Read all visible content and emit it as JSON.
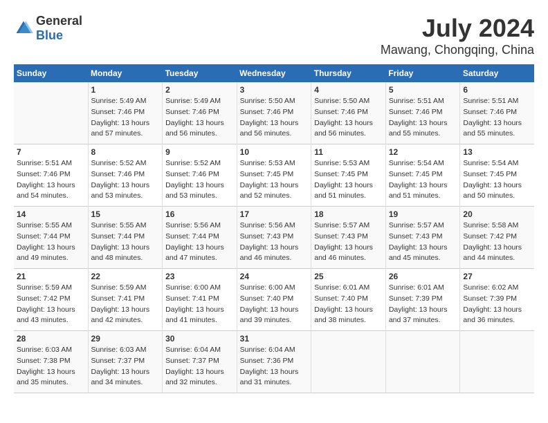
{
  "logo": {
    "text_general": "General",
    "text_blue": "Blue"
  },
  "title": "July 2024",
  "subtitle": "Mawang, Chongqing, China",
  "days_of_week": [
    "Sunday",
    "Monday",
    "Tuesday",
    "Wednesday",
    "Thursday",
    "Friday",
    "Saturday"
  ],
  "weeks": [
    [
      {
        "day": "",
        "sunrise": "",
        "sunset": "",
        "daylight": ""
      },
      {
        "day": "1",
        "sunrise": "Sunrise: 5:49 AM",
        "sunset": "Sunset: 7:46 PM",
        "daylight": "Daylight: 13 hours and 57 minutes."
      },
      {
        "day": "2",
        "sunrise": "Sunrise: 5:49 AM",
        "sunset": "Sunset: 7:46 PM",
        "daylight": "Daylight: 13 hours and 56 minutes."
      },
      {
        "day": "3",
        "sunrise": "Sunrise: 5:50 AM",
        "sunset": "Sunset: 7:46 PM",
        "daylight": "Daylight: 13 hours and 56 minutes."
      },
      {
        "day": "4",
        "sunrise": "Sunrise: 5:50 AM",
        "sunset": "Sunset: 7:46 PM",
        "daylight": "Daylight: 13 hours and 56 minutes."
      },
      {
        "day": "5",
        "sunrise": "Sunrise: 5:51 AM",
        "sunset": "Sunset: 7:46 PM",
        "daylight": "Daylight: 13 hours and 55 minutes."
      },
      {
        "day": "6",
        "sunrise": "Sunrise: 5:51 AM",
        "sunset": "Sunset: 7:46 PM",
        "daylight": "Daylight: 13 hours and 55 minutes."
      }
    ],
    [
      {
        "day": "7",
        "sunrise": "Sunrise: 5:51 AM",
        "sunset": "Sunset: 7:46 PM",
        "daylight": "Daylight: 13 hours and 54 minutes."
      },
      {
        "day": "8",
        "sunrise": "Sunrise: 5:52 AM",
        "sunset": "Sunset: 7:46 PM",
        "daylight": "Daylight: 13 hours and 53 minutes."
      },
      {
        "day": "9",
        "sunrise": "Sunrise: 5:52 AM",
        "sunset": "Sunset: 7:46 PM",
        "daylight": "Daylight: 13 hours and 53 minutes."
      },
      {
        "day": "10",
        "sunrise": "Sunrise: 5:53 AM",
        "sunset": "Sunset: 7:45 PM",
        "daylight": "Daylight: 13 hours and 52 minutes."
      },
      {
        "day": "11",
        "sunrise": "Sunrise: 5:53 AM",
        "sunset": "Sunset: 7:45 PM",
        "daylight": "Daylight: 13 hours and 51 minutes."
      },
      {
        "day": "12",
        "sunrise": "Sunrise: 5:54 AM",
        "sunset": "Sunset: 7:45 PM",
        "daylight": "Daylight: 13 hours and 51 minutes."
      },
      {
        "day": "13",
        "sunrise": "Sunrise: 5:54 AM",
        "sunset": "Sunset: 7:45 PM",
        "daylight": "Daylight: 13 hours and 50 minutes."
      }
    ],
    [
      {
        "day": "14",
        "sunrise": "Sunrise: 5:55 AM",
        "sunset": "Sunset: 7:44 PM",
        "daylight": "Daylight: 13 hours and 49 minutes."
      },
      {
        "day": "15",
        "sunrise": "Sunrise: 5:55 AM",
        "sunset": "Sunset: 7:44 PM",
        "daylight": "Daylight: 13 hours and 48 minutes."
      },
      {
        "day": "16",
        "sunrise": "Sunrise: 5:56 AM",
        "sunset": "Sunset: 7:44 PM",
        "daylight": "Daylight: 13 hours and 47 minutes."
      },
      {
        "day": "17",
        "sunrise": "Sunrise: 5:56 AM",
        "sunset": "Sunset: 7:43 PM",
        "daylight": "Daylight: 13 hours and 46 minutes."
      },
      {
        "day": "18",
        "sunrise": "Sunrise: 5:57 AM",
        "sunset": "Sunset: 7:43 PM",
        "daylight": "Daylight: 13 hours and 46 minutes."
      },
      {
        "day": "19",
        "sunrise": "Sunrise: 5:57 AM",
        "sunset": "Sunset: 7:43 PM",
        "daylight": "Daylight: 13 hours and 45 minutes."
      },
      {
        "day": "20",
        "sunrise": "Sunrise: 5:58 AM",
        "sunset": "Sunset: 7:42 PM",
        "daylight": "Daylight: 13 hours and 44 minutes."
      }
    ],
    [
      {
        "day": "21",
        "sunrise": "Sunrise: 5:59 AM",
        "sunset": "Sunset: 7:42 PM",
        "daylight": "Daylight: 13 hours and 43 minutes."
      },
      {
        "day": "22",
        "sunrise": "Sunrise: 5:59 AM",
        "sunset": "Sunset: 7:41 PM",
        "daylight": "Daylight: 13 hours and 42 minutes."
      },
      {
        "day": "23",
        "sunrise": "Sunrise: 6:00 AM",
        "sunset": "Sunset: 7:41 PM",
        "daylight": "Daylight: 13 hours and 41 minutes."
      },
      {
        "day": "24",
        "sunrise": "Sunrise: 6:00 AM",
        "sunset": "Sunset: 7:40 PM",
        "daylight": "Daylight: 13 hours and 39 minutes."
      },
      {
        "day": "25",
        "sunrise": "Sunrise: 6:01 AM",
        "sunset": "Sunset: 7:40 PM",
        "daylight": "Daylight: 13 hours and 38 minutes."
      },
      {
        "day": "26",
        "sunrise": "Sunrise: 6:01 AM",
        "sunset": "Sunset: 7:39 PM",
        "daylight": "Daylight: 13 hours and 37 minutes."
      },
      {
        "day": "27",
        "sunrise": "Sunrise: 6:02 AM",
        "sunset": "Sunset: 7:39 PM",
        "daylight": "Daylight: 13 hours and 36 minutes."
      }
    ],
    [
      {
        "day": "28",
        "sunrise": "Sunrise: 6:03 AM",
        "sunset": "Sunset: 7:38 PM",
        "daylight": "Daylight: 13 hours and 35 minutes."
      },
      {
        "day": "29",
        "sunrise": "Sunrise: 6:03 AM",
        "sunset": "Sunset: 7:37 PM",
        "daylight": "Daylight: 13 hours and 34 minutes."
      },
      {
        "day": "30",
        "sunrise": "Sunrise: 6:04 AM",
        "sunset": "Sunset: 7:37 PM",
        "daylight": "Daylight: 13 hours and 32 minutes."
      },
      {
        "day": "31",
        "sunrise": "Sunrise: 6:04 AM",
        "sunset": "Sunset: 7:36 PM",
        "daylight": "Daylight: 13 hours and 31 minutes."
      },
      {
        "day": "",
        "sunrise": "",
        "sunset": "",
        "daylight": ""
      },
      {
        "day": "",
        "sunrise": "",
        "sunset": "",
        "daylight": ""
      },
      {
        "day": "",
        "sunrise": "",
        "sunset": "",
        "daylight": ""
      }
    ]
  ],
  "colors": {
    "header_bg": "#2a6db5",
    "header_text": "#ffffff",
    "accent": "#2a6db5"
  }
}
